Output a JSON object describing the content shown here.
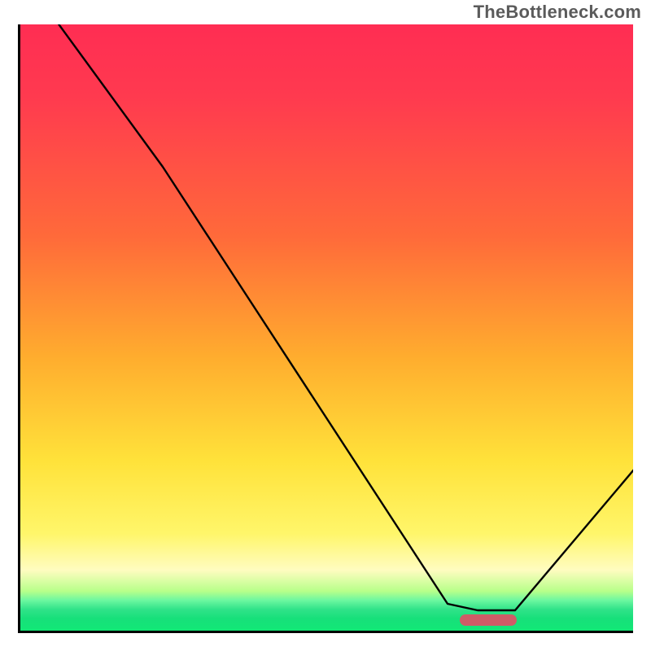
{
  "watermark": "TheBottleneck.com",
  "colors": {
    "gradient_top": "#ff2d53",
    "gradient_mid_orange": "#ffad2e",
    "gradient_yellow": "#ffe23a",
    "gradient_pale": "#fffcc0",
    "gradient_green": "#12e876",
    "curve": "#000000",
    "marker": "#cf5d67",
    "axis": "#000000"
  },
  "chart_data": {
    "type": "line",
    "title": "",
    "xlabel": "",
    "ylabel": "",
    "xlim": [
      0,
      100
    ],
    "ylim": [
      0,
      100
    ],
    "grid": false,
    "legend": false,
    "background": "vertical red→yellow→green gradient indicating bottleneck severity (red = high bottleneck near top, green = balanced near bottom)",
    "series": [
      {
        "name": "bottleneck-curve",
        "x": [
          5,
          23,
          70,
          75,
          81,
          100
        ],
        "y": [
          101,
          77,
          4,
          3,
          3,
          28
        ],
        "note": "y is bottleneck severity percent (0 at bottom/green, 100 at top/red); curve starts above frame, drops steeply with slight knee around x≈23, reaches minimum plateau around x≈75–81 at the green band, then rises again toward x=100"
      }
    ],
    "markers": [
      {
        "name": "optimum-zone",
        "shape": "rounded-bar",
        "x_range": [
          72,
          81
        ],
        "y": 2,
        "color": "#cf5d67",
        "meaning": "optimal / balanced region along x-axis"
      }
    ]
  }
}
